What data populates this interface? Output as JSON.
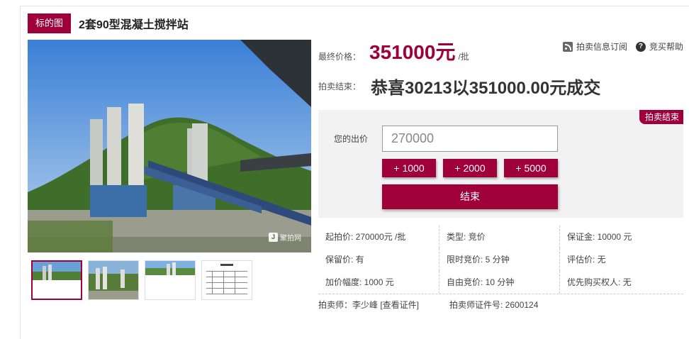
{
  "title": {
    "tag": "标的图",
    "text": "2套90型混凝土搅拌站"
  },
  "watermark": "聚拍网",
  "price": {
    "label": "最终价格：",
    "value": "351000元",
    "unit": "/批"
  },
  "links": [
    {
      "label": "拍卖信息订阅",
      "icon": "rss-icon"
    },
    {
      "label": "竞买帮助",
      "icon": "help-icon"
    }
  ],
  "result": {
    "label": "拍卖结束：",
    "text": "恭喜30213以351000.00元成交"
  },
  "bid": {
    "badge": "拍卖结束",
    "label": "您的出价",
    "value": "270000",
    "increments": [
      "+ 1000",
      "+ 2000",
      "+ 5000"
    ],
    "end_button": "结束"
  },
  "info": [
    [
      "起拍价: 270000元 /批",
      "类型: 竞价",
      "保证金: 10000 元"
    ],
    [
      "保留价: 有",
      "限时竞价: 5 分钟",
      "评估价: 无"
    ],
    [
      "加价幅度: 1000 元",
      "自由竞价: 10 分钟",
      "优先购买权人: 无"
    ]
  ],
  "auctioneer": {
    "name": "拍卖师：李少峰 [查看证件]",
    "cert": "拍卖师证件号: 2600124"
  },
  "colors": {
    "accent": "#a0003a"
  }
}
